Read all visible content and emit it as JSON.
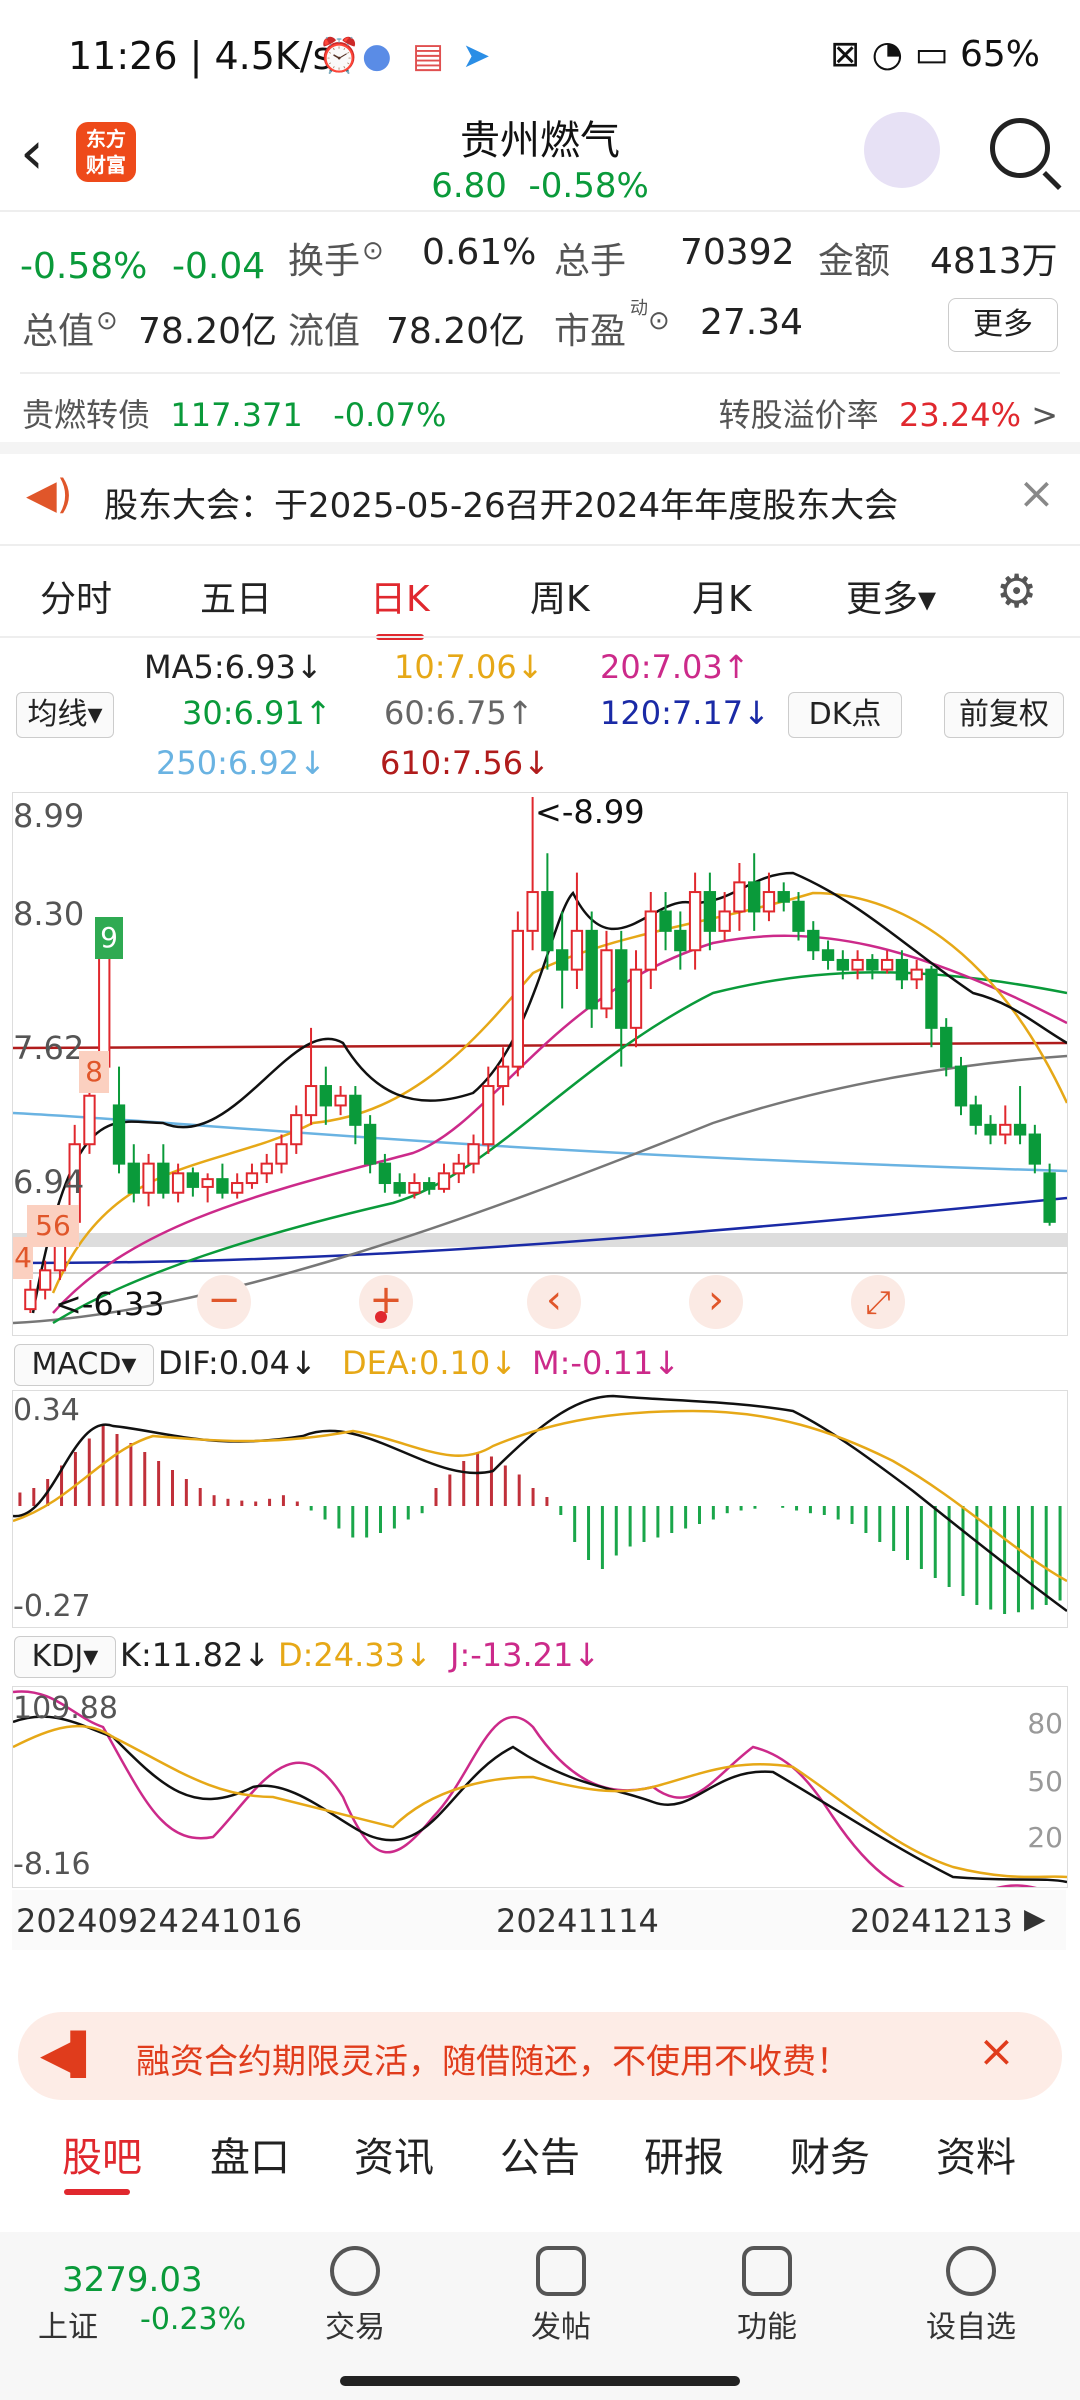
{
  "status": {
    "time": "11:26",
    "speed": "4.5K/s",
    "battery": "65%"
  },
  "header": {
    "back": "‹",
    "logo_line1": "东方",
    "logo_line2": "财富",
    "title": "贵州燃气",
    "price": "6.80",
    "change_pct": "-0.58%"
  },
  "quote": {
    "change_pct": "-0.58%",
    "change": "-0.04",
    "turnover_label": "换手",
    "turnover": "0.61%",
    "volume_label": "总手",
    "volume": "70392",
    "amount_label": "金额",
    "amount": "4813万",
    "mktcap_label": "总值",
    "mktcap": "78.20亿",
    "float_label": "流值",
    "float": "78.20亿",
    "pe_label": "市盈",
    "pe_sup": "动",
    "pe": "27.34",
    "more": "更多"
  },
  "bond": {
    "name": "贵燃转债",
    "price": "117.371",
    "change": "-0.07%",
    "premium_label": "转股溢价率",
    "premium": "23.24%",
    "arrow": ">"
  },
  "notice": {
    "text": "股东大会：于2025-05-26召开2024年年度股东大会",
    "close": "×"
  },
  "tabs": [
    "分时",
    "五日",
    "日K",
    "周K",
    "月K",
    "更多▾"
  ],
  "ma": {
    "selector": "均线▾",
    "ma5": "MA5:6.93↓",
    "ma10": "10:7.06↓",
    "ma20": "20:7.03↑",
    "ma30": "30:6.91↑",
    "ma60": "60:6.75↑",
    "ma120": "120:7.17↓",
    "ma250": "250:6.92↓",
    "ma610": "610:7.56↓",
    "dk": "DK点",
    "adjust": "前复权"
  },
  "kline": {
    "y_labels": [
      "8.99",
      "8.30",
      "7.62",
      "6.94"
    ],
    "high_note": "<-8.99",
    "low_note": "<-6.33",
    "tags": [
      "9",
      "8",
      "56",
      "4"
    ],
    "ctrl": [
      "−",
      "+",
      "‹",
      "›",
      "⤢"
    ]
  },
  "macd": {
    "selector": "MACD▾",
    "dif": "DIF:0.04↓",
    "dea": "DEA:0.10↓",
    "m": "M:-0.11↓",
    "ymax": "0.34",
    "ymin": "-0.27"
  },
  "kdj": {
    "selector": "KDJ▾",
    "k": "K:11.82↓",
    "d": "D:24.33↓",
    "j": "J:-13.21↓",
    "ymax": "109.88",
    "ymin": "-8.16",
    "levels": [
      "80",
      "50",
      "20"
    ]
  },
  "x_labels": [
    "20240924",
    "241016",
    "20241114",
    "20241213"
  ],
  "chart_data": {
    "type": "candlestick",
    "ylim": [
      6.33,
      8.99
    ],
    "candles": [
      [
        6.35,
        6.45,
        6.33,
        6.5
      ],
      [
        6.45,
        6.55,
        6.4,
        6.6
      ],
      [
        6.55,
        6.8,
        6.5,
        6.85
      ],
      [
        6.8,
        7.2,
        6.78,
        7.3
      ],
      [
        7.2,
        7.45,
        7.15,
        7.5
      ],
      [
        7.6,
        8.2,
        7.55,
        8.3
      ],
      [
        7.4,
        7.1,
        7.05,
        7.6
      ],
      [
        7.1,
        6.95,
        6.9,
        7.2
      ],
      [
        6.95,
        7.1,
        6.88,
        7.15
      ],
      [
        7.1,
        6.95,
        6.92,
        7.2
      ],
      [
        6.95,
        7.05,
        6.9,
        7.1
      ],
      [
        7.05,
        6.98,
        6.93,
        7.08
      ],
      [
        6.98,
        7.02,
        6.9,
        7.05
      ],
      [
        7.02,
        6.95,
        6.92,
        7.1
      ],
      [
        6.95,
        7.0,
        6.92,
        7.05
      ],
      [
        7.0,
        7.05,
        6.97,
        7.1
      ],
      [
        7.05,
        7.1,
        7.0,
        7.15
      ],
      [
        7.1,
        7.2,
        7.05,
        7.25
      ],
      [
        7.2,
        7.35,
        7.15,
        7.4
      ],
      [
        7.35,
        7.5,
        7.3,
        7.8
      ],
      [
        7.5,
        7.4,
        7.3,
        7.6
      ],
      [
        7.4,
        7.45,
        7.35,
        7.5
      ],
      [
        7.45,
        7.3,
        7.2,
        7.5
      ],
      [
        7.3,
        7.1,
        7.05,
        7.35
      ],
      [
        7.1,
        7.0,
        6.95,
        7.15
      ],
      [
        7.0,
        6.95,
        6.93,
        7.05
      ],
      [
        6.95,
        7.0,
        6.92,
        7.05
      ],
      [
        7.0,
        6.97,
        6.94,
        7.03
      ],
      [
        6.97,
        7.05,
        6.95,
        7.1
      ],
      [
        7.05,
        7.1,
        7.0,
        7.15
      ],
      [
        7.1,
        7.2,
        7.05,
        7.25
      ],
      [
        7.2,
        7.5,
        7.15,
        7.6
      ],
      [
        7.5,
        7.6,
        7.4,
        7.7
      ],
      [
        7.6,
        8.3,
        7.55,
        8.4
      ],
      [
        8.3,
        8.5,
        8.2,
        8.99
      ],
      [
        8.5,
        8.2,
        8.1,
        8.7
      ],
      [
        8.2,
        8.1,
        7.9,
        8.4
      ],
      [
        8.1,
        8.3,
        8.0,
        8.6
      ],
      [
        8.3,
        7.9,
        7.8,
        8.4
      ],
      [
        7.9,
        8.2,
        7.85,
        8.3
      ],
      [
        8.2,
        7.8,
        7.6,
        8.3
      ],
      [
        7.8,
        8.1,
        7.7,
        8.2
      ],
      [
        8.1,
        8.4,
        8.0,
        8.5
      ],
      [
        8.4,
        8.3,
        8.2,
        8.5
      ],
      [
        8.3,
        8.2,
        8.1,
        8.4
      ],
      [
        8.2,
        8.5,
        8.1,
        8.6
      ],
      [
        8.5,
        8.3,
        8.2,
        8.6
      ],
      [
        8.3,
        8.4,
        8.25,
        8.5
      ],
      [
        8.4,
        8.55,
        8.3,
        8.65
      ],
      [
        8.55,
        8.4,
        8.3,
        8.7
      ],
      [
        8.4,
        8.5,
        8.35,
        8.6
      ],
      [
        8.5,
        8.45,
        8.4,
        8.55
      ],
      [
        8.45,
        8.3,
        8.25,
        8.5
      ],
      [
        8.3,
        8.2,
        8.15,
        8.35
      ],
      [
        8.2,
        8.15,
        8.1,
        8.25
      ],
      [
        8.15,
        8.1,
        8.05,
        8.2
      ],
      [
        8.1,
        8.15,
        8.05,
        8.2
      ],
      [
        8.15,
        8.1,
        8.05,
        8.18
      ],
      [
        8.1,
        8.15,
        8.08,
        8.2
      ],
      [
        8.15,
        8.05,
        8.0,
        8.2
      ],
      [
        8.05,
        8.1,
        8.0,
        8.15
      ],
      [
        8.1,
        7.8,
        7.7,
        8.12
      ],
      [
        7.8,
        7.6,
        7.55,
        7.85
      ],
      [
        7.6,
        7.4,
        7.35,
        7.65
      ],
      [
        7.4,
        7.3,
        7.25,
        7.45
      ],
      [
        7.3,
        7.25,
        7.2,
        7.35
      ],
      [
        7.25,
        7.3,
        7.2,
        7.4
      ],
      [
        7.3,
        7.25,
        7.2,
        7.5
      ],
      [
        7.25,
        7.1,
        7.05,
        7.3
      ],
      [
        7.05,
        6.8,
        6.78,
        7.1
      ]
    ]
  }
}
